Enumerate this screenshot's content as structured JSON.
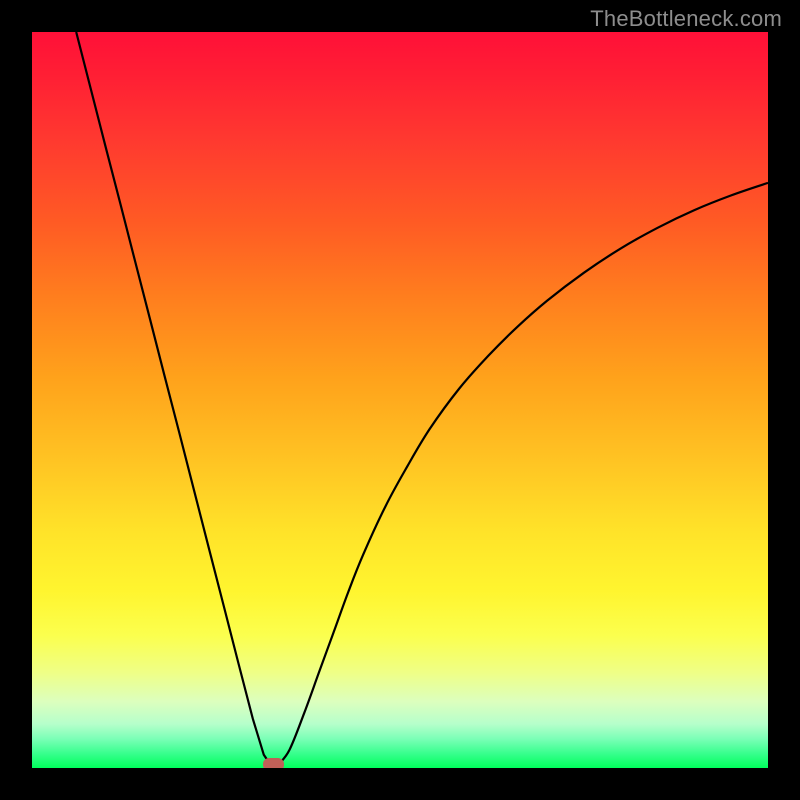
{
  "watermark": "TheBottleneck.com",
  "colors": {
    "background": "#000000",
    "curve": "#000000",
    "marker": "#c06058"
  },
  "chart_data": {
    "type": "line",
    "title": "",
    "xlabel": "",
    "ylabel": "",
    "xlim": [
      0,
      100
    ],
    "ylim": [
      0,
      100
    ],
    "series": [
      {
        "name": "left-branch",
        "x": [
          6,
          8,
          10,
          12,
          14,
          16,
          18,
          20,
          22,
          24,
          26,
          28,
          30,
          31.5,
          32.5
        ],
        "y": [
          100,
          92.2,
          84.4,
          76.7,
          68.9,
          61.1,
          53.3,
          45.6,
          37.8,
          30,
          22.2,
          14.4,
          6.7,
          1.8,
          0.3
        ]
      },
      {
        "name": "right-branch",
        "x": [
          33.5,
          35,
          37,
          39,
          41,
          43,
          45,
          48,
          51,
          54,
          58,
          62,
          66,
          70,
          75,
          80,
          85,
          90,
          95,
          100
        ],
        "y": [
          0.5,
          2.5,
          7.5,
          13,
          18.5,
          24,
          29,
          35.5,
          41,
          46,
          51.5,
          56,
          60,
          63.5,
          67.3,
          70.6,
          73.4,
          75.8,
          77.8,
          79.5
        ]
      }
    ],
    "marker": {
      "x": 32.8,
      "y": 0.5,
      "width_pct": 2.9,
      "height_pct": 1.7
    }
  }
}
